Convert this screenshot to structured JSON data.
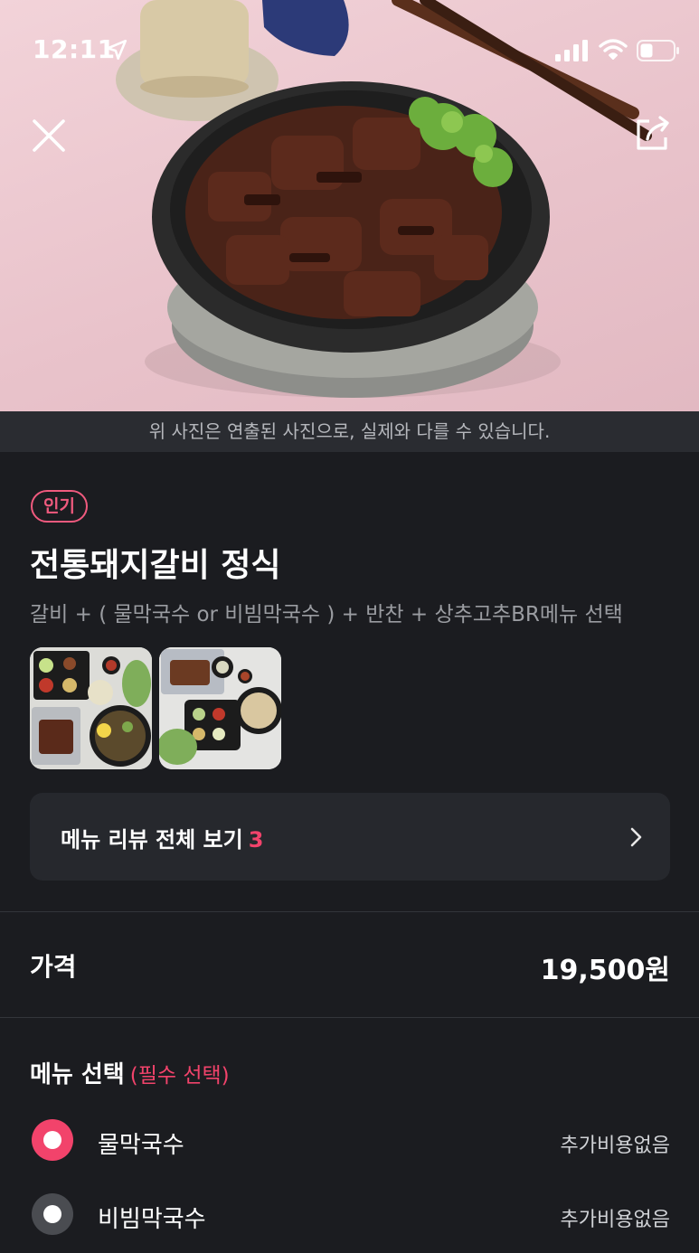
{
  "status_bar": {
    "time": "12:11",
    "icons": [
      "location-arrow-icon",
      "signal-icon",
      "wifi-icon",
      "battery-icon"
    ]
  },
  "hero": {
    "photo": "bowl of grilled pork galbi with lettuce garnish",
    "close_icon": "close-icon",
    "share_icon": "share-icon",
    "notice": "위 사진은 연출된 사진으로, 실제와 다를 수 있습니다."
  },
  "item": {
    "badge": "인기",
    "title": "전통돼지갈비 정식",
    "description": "갈비 + ( 물막국수 or 비빔막국수 ) + 반찬 + 상추고추BR메뉴 선택",
    "thumbnails": [
      "meal-set-photo-1",
      "meal-set-photo-2"
    ]
  },
  "review": {
    "label": "메뉴 리뷰 전체 보기",
    "count": "3"
  },
  "price": {
    "label": "가격",
    "value": "19,500원"
  },
  "menu_select": {
    "heading": "메뉴 선택",
    "required": "(필수 선택)",
    "options": [
      {
        "label": "물막국수",
        "price": "추가비용없음",
        "selected": true
      },
      {
        "label": "비빔막국수",
        "price": "추가비용없음",
        "selected": false
      }
    ]
  },
  "colors": {
    "background": "#1b1c20",
    "accent": "#f2436b",
    "card": "#26282d",
    "notice_bar": "#2a2c31"
  }
}
